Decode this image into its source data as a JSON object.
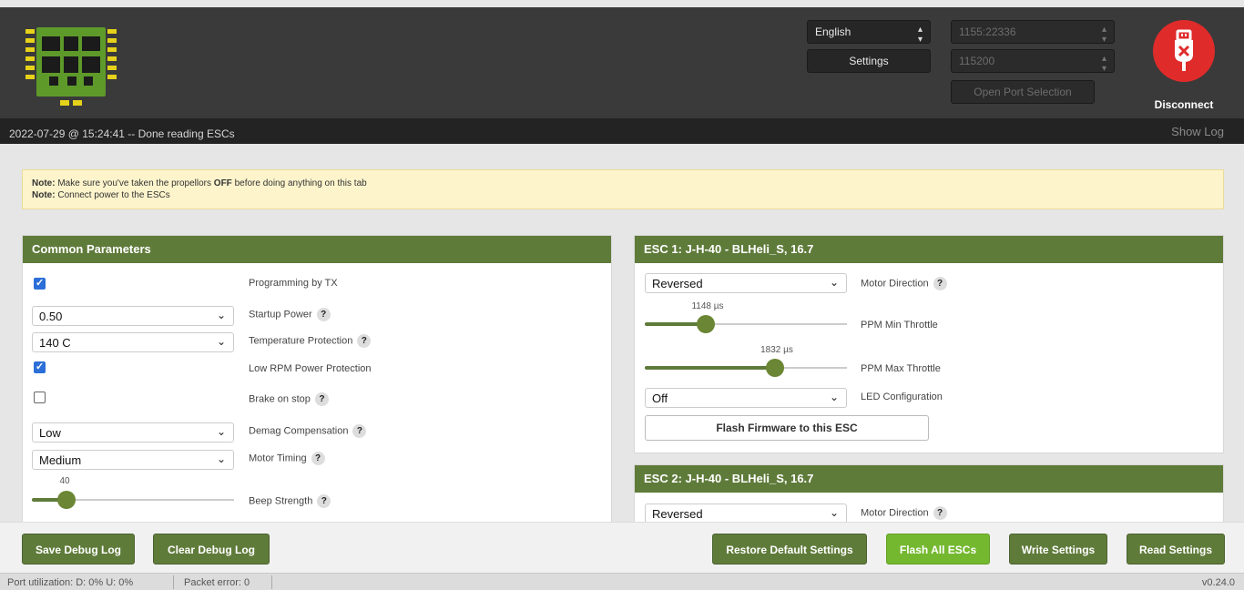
{
  "header": {
    "language": "English",
    "settings_label": "Settings",
    "port": "1155:22336",
    "baud": "115200",
    "open_port_label": "Open Port Selection",
    "disconnect_label": "Disconnect"
  },
  "log": {
    "message": "2022-07-29 @ 15:24:41 -- Done reading ESCs",
    "show_log": "Show Log"
  },
  "note": {
    "line1_prefix": "Note:",
    "line1_text_a": "Make sure you've taken the propellors",
    "line1_bold": "OFF",
    "line1_text_b": "before doing anything on this tab",
    "line2_prefix": "Note:",
    "line2_text": "Connect power to the ESCs"
  },
  "common": {
    "title": "Common Parameters",
    "programming_label": "Programming by TX",
    "startup_value": "0.50",
    "startup_label": "Startup Power",
    "temp_value": "140 C",
    "temp_label": "Temperature Protection",
    "lowrpm_label": "Low RPM Power Protection",
    "brake_label": "Brake on stop",
    "demag_value": "Low",
    "demag_label": "Demag Compensation",
    "timing_value": "Medium",
    "timing_label": "Motor Timing",
    "beep_value": "40",
    "beep_label": "Beep Strength",
    "beep_level": 0.17
  },
  "esc1": {
    "title": "ESC 1: J-H-40 - BLHeli_S, 16.7",
    "direction_value": "Reversed",
    "direction_label": "Motor Direction",
    "min_value": "1148 µs",
    "min_label": "PPM Min Throttle",
    "max_value": "1832 µs",
    "max_label": "PPM Max Throttle",
    "led_value": "Off",
    "led_label": "LED Configuration",
    "flash_label": "Flash Firmware to this ESC"
  },
  "esc2": {
    "title": "ESC 2: J-H-40 - BLHeli_S, 16.7",
    "direction_value": "Reversed",
    "direction_label": "Motor Direction"
  },
  "footer": {
    "save_debug": "Save Debug Log",
    "clear_debug": "Clear Debug Log",
    "restore": "Restore Default Settings",
    "flash_all": "Flash All ESCs",
    "write": "Write Settings",
    "read": "Read Settings"
  },
  "status": {
    "port_util": "Port utilization: D: 0% U: 0%",
    "packet_error": "Packet error: 0",
    "version": "v0.24.0"
  },
  "colors": {
    "accent_green": "#5f7b3a",
    "flash_green": "#74b82f",
    "disconnect_red": "#e02b2b"
  }
}
